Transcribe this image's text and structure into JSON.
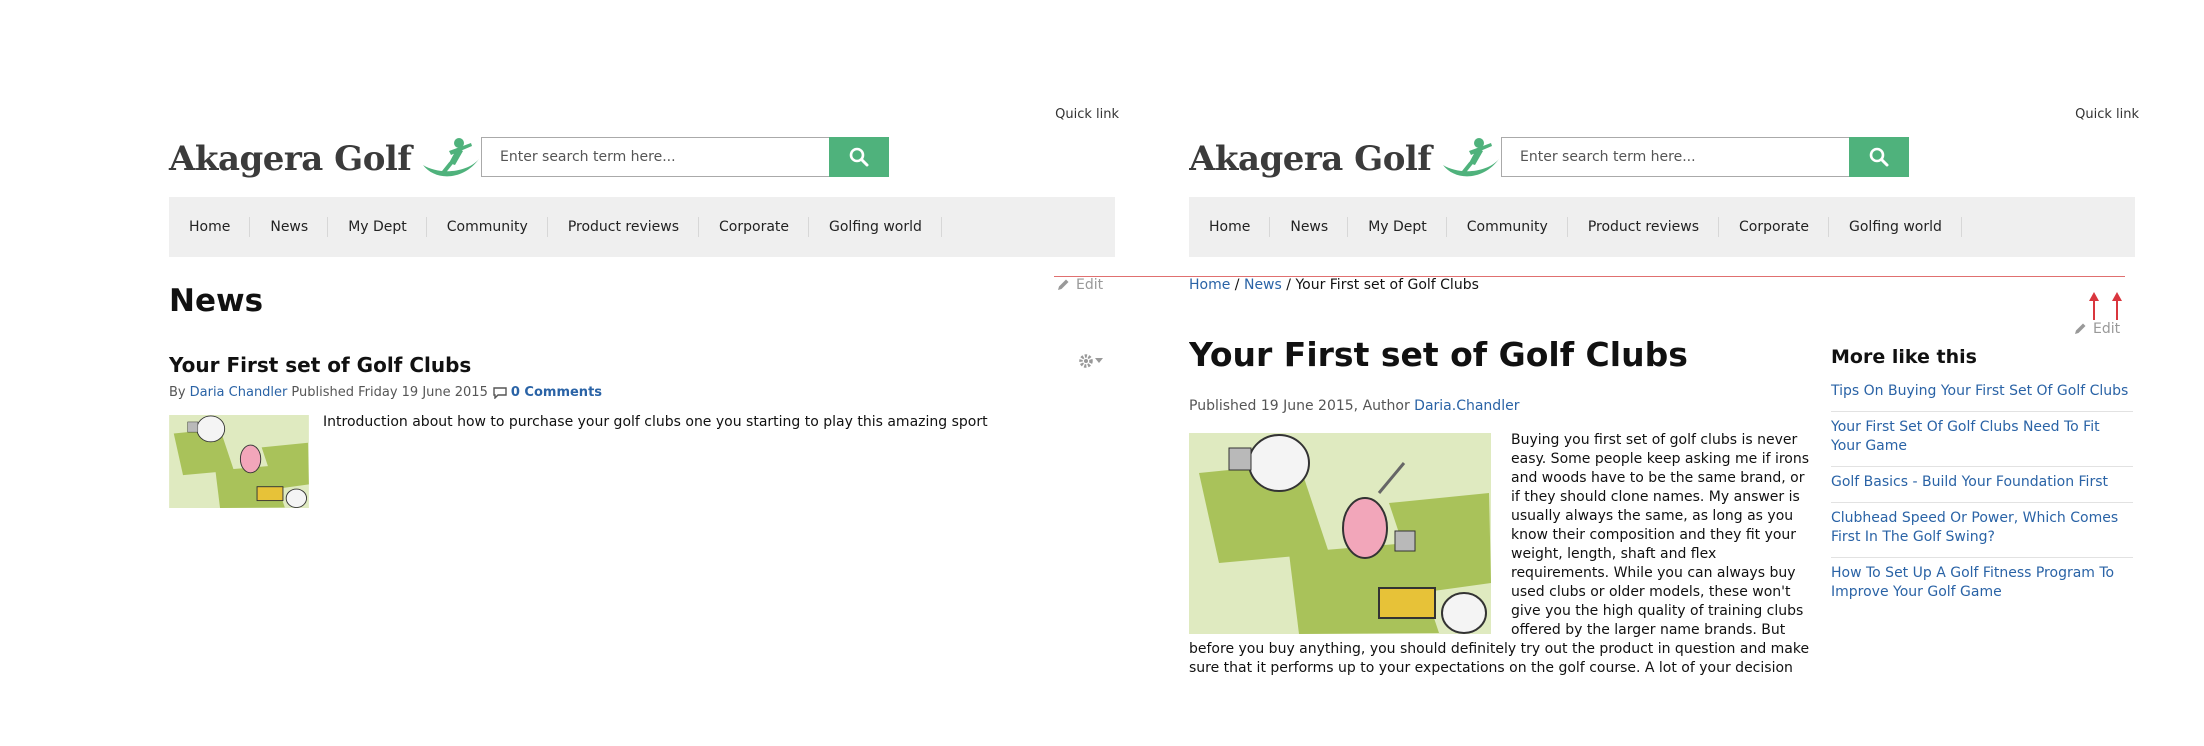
{
  "site": {
    "name": "Akagera Golf",
    "quick_link": "Quick link"
  },
  "search": {
    "placeholder": "Enter search term here..."
  },
  "nav": [
    "Home",
    "News",
    "My Dept",
    "Community",
    "Product reviews",
    "Corporate",
    "Golfing world"
  ],
  "left": {
    "page_title": "News",
    "edit_label": "Edit",
    "teaser": {
      "title": "Your First set of Golf Clubs",
      "by_label": "By",
      "author": "Daria Chandler",
      "published": "Published Friday 19 June 2015",
      "comments": "0 Comments",
      "summary": "Introduction about how to purchase your golf clubs one you starting to play this amazing sport"
    }
  },
  "right": {
    "breadcrumb": {
      "home": "Home",
      "sep": "/",
      "news": "News",
      "current": "Your First set of Golf Clubs"
    },
    "edit_label": "Edit",
    "article": {
      "title": "Your First set of Golf Clubs",
      "meta_prefix": "Published 19 June 2015, Author",
      "author": "Daria.Chandler",
      "body": "Buying you first set of golf clubs is never easy. Some people keep asking me if irons and woods have to be the same brand, or if they should clone names. My answer is usually always the same, as long as you know their composition and they fit your weight, length, shaft and flex requirements. While you can always buy used clubs or older models, these won't give you the high quality of training clubs offered by the larger name brands. But before you buy anything, you should definitely try out the product in question and make sure that it performs up to your expectations on the golf course. A lot of your decision will have to do"
    },
    "more_like_this": {
      "title": "More like this",
      "items": [
        "Tips On Buying Your First Set Of Golf Clubs",
        "Your First Set Of Golf Clubs Need To Fit Your Game",
        "Golf Basics - Build Your Foundation First",
        "Clubhead Speed Or Power, Which Comes First In The Golf Swing?",
        "How To Set Up A Golf Fitness Program To Improve Your Golf Game"
      ]
    }
  },
  "colors": {
    "brand_green": "#4fb27c",
    "link_blue": "#2a63a6",
    "nav_bg": "#efefef",
    "annotation_red": "#d9363e"
  }
}
